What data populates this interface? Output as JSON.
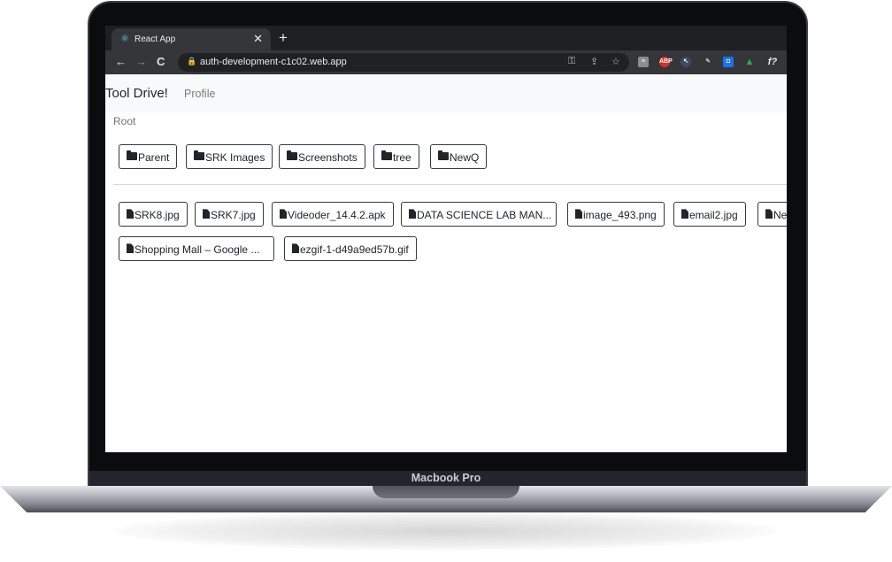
{
  "laptop": {
    "label": "Macbook Pro"
  },
  "browser": {
    "tab": {
      "title": "React App",
      "close_glyph": "✕"
    },
    "new_tab_glyph": "+",
    "nav": {
      "back": "←",
      "forward": "→",
      "reload": "C"
    },
    "url": "auth-development-c1c02.web.app",
    "extensions": [
      "key-icon",
      "share-icon",
      "star-icon",
      "abp-icon",
      "drive-icon",
      "f?-icon"
    ]
  },
  "app": {
    "brand": "Tool Drive!",
    "nav_profile": "Profile",
    "breadcrumb": "Root",
    "folders": [
      "Parent",
      "SRK Images",
      "Screenshots",
      "tree",
      "NewQ"
    ],
    "files": [
      "SRK8.jpg",
      "SRK7.jpg",
      "Videoder_14.4.2.apk",
      "DATA SCIENCE LAB MAN...",
      "image_493.png",
      "email2.jpg",
      "Ne",
      "Shopping Mall – Google ...",
      "ezgif-1-d49a9ed57b.gif"
    ]
  },
  "colors": {
    "accent": "#212529",
    "navbar_bg": "#f8f9fa",
    "browser_dark": "#35363a"
  }
}
